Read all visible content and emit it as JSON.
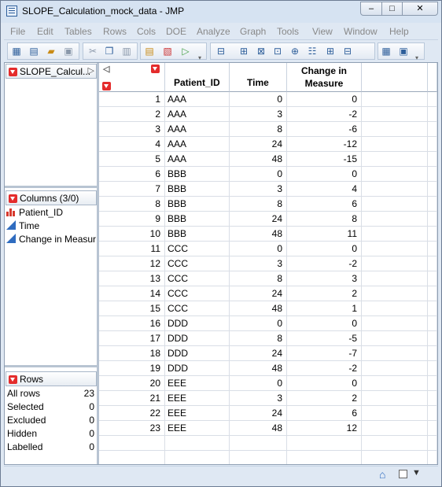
{
  "window": {
    "title": "SLOPE_Calculation_mock_data - JMP",
    "minimize": "–",
    "maximize": "□",
    "close": "✕"
  },
  "menu": [
    "File",
    "Edit",
    "Tables",
    "Rows",
    "Cols",
    "DOE",
    "Analyze",
    "Graph",
    "Tools",
    "View",
    "Window",
    "Help"
  ],
  "table_panel": {
    "name": "SLOPE_Calcul..."
  },
  "columns_panel": {
    "header": "Columns (3/0)",
    "items": [
      {
        "name": "Patient_ID",
        "icon": "nominal-bar-icon"
      },
      {
        "name": "Time",
        "icon": "continuous-triangle-icon"
      },
      {
        "name": "Change in Measur",
        "icon": "continuous-triangle-icon"
      }
    ]
  },
  "rows_panel": {
    "header": "Rows",
    "stats": [
      {
        "label": "All rows",
        "value": "23"
      },
      {
        "label": "Selected",
        "value": "0"
      },
      {
        "label": "Excluded",
        "value": "0"
      },
      {
        "label": "Hidden",
        "value": "0"
      },
      {
        "label": "Labelled",
        "value": "0"
      }
    ]
  },
  "grid": {
    "headers": [
      "Patient_ID",
      "Time",
      "Change in",
      "Measure"
    ],
    "rows": [
      [
        "1",
        "AAA",
        "0",
        "0"
      ],
      [
        "2",
        "AAA",
        "3",
        "-2"
      ],
      [
        "3",
        "AAA",
        "8",
        "-6"
      ],
      [
        "4",
        "AAA",
        "24",
        "-12"
      ],
      [
        "5",
        "AAA",
        "48",
        "-15"
      ],
      [
        "6",
        "BBB",
        "0",
        "0"
      ],
      [
        "7",
        "BBB",
        "3",
        "4"
      ],
      [
        "8",
        "BBB",
        "8",
        "6"
      ],
      [
        "9",
        "BBB",
        "24",
        "8"
      ],
      [
        "10",
        "BBB",
        "48",
        "11"
      ],
      [
        "11",
        "CCC",
        "0",
        "0"
      ],
      [
        "12",
        "CCC",
        "3",
        "-2"
      ],
      [
        "13",
        "CCC",
        "8",
        "3"
      ],
      [
        "14",
        "CCC",
        "24",
        "2"
      ],
      [
        "15",
        "CCC",
        "48",
        "1"
      ],
      [
        "16",
        "DDD",
        "0",
        "0"
      ],
      [
        "17",
        "DDD",
        "8",
        "-5"
      ],
      [
        "18",
        "DDD",
        "24",
        "-7"
      ],
      [
        "19",
        "DDD",
        "48",
        "-2"
      ],
      [
        "20",
        "EEE",
        "0",
        "0"
      ],
      [
        "21",
        "EEE",
        "3",
        "2"
      ],
      [
        "22",
        "EEE",
        "24",
        "6"
      ],
      [
        "23",
        "EEE",
        "48",
        "12"
      ]
    ]
  },
  "statusbar": {
    "home_icon": "home-icon",
    "toggle_icon": "checkbox-icon",
    "menu_icon": "dropdown-arrow-icon"
  },
  "colors": {
    "accent": "#2d5e9a",
    "hotspot": "#e42c2c",
    "chrome": "#dfe8f3"
  }
}
